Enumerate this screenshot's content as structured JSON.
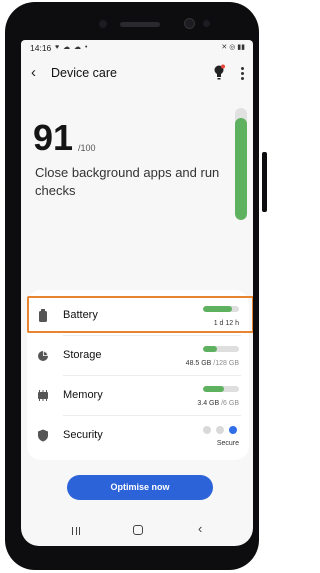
{
  "status_bar": {
    "time": "14:16",
    "left_icons": "♥ ☁ ☁ •",
    "right_icons": "✕ ◎ ▮▮"
  },
  "header": {
    "title": "Device care",
    "back_icon": "chevron-left-icon",
    "tip_icon": "lightbulb-icon",
    "menu_icon": "more-vertical-icon"
  },
  "score": {
    "value": "91",
    "max": "/100",
    "message": "Close background apps and run checks",
    "level": 0.91
  },
  "items": [
    {
      "label": "Battery",
      "icon": "battery-icon",
      "value": "1 d 12 h",
      "muted": "",
      "fill": 0.8
    },
    {
      "label": "Storage",
      "icon": "pie-chart-icon",
      "value": "48.5 GB",
      "muted": " /128 GB",
      "fill": 0.38
    },
    {
      "label": "Memory",
      "icon": "memory-chip-icon",
      "value": "3.4 GB",
      "muted": " /6 GB",
      "fill": 0.57
    },
    {
      "label": "Security",
      "icon": "shield-icon",
      "value": "Secure",
      "muted": ""
    }
  ],
  "optimise_button": {
    "label": "Optimise now"
  },
  "nav": {
    "recents_icon": "recents-icon",
    "home_icon": "home-icon",
    "back_icon": "back-icon"
  },
  "colors": {
    "accent": "#2c63d9",
    "good": "#5eb15f",
    "highlight": "#e8832f",
    "security_on": "#2f6ee8"
  }
}
